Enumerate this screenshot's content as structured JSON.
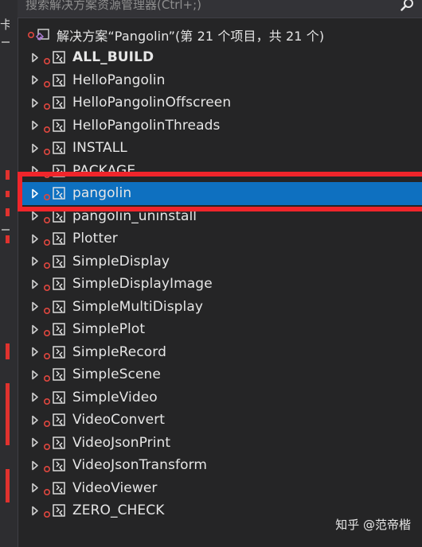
{
  "search": {
    "placeholder": "搜索解决方案资源管理器(Ctrl+;)"
  },
  "gutter": {
    "glyph": "卡"
  },
  "solution": {
    "label": "解决方案“Pangolin”(第 21 个项目，共 21 个)"
  },
  "projects": [
    {
      "label": "ALL_BUILD",
      "bold": true
    },
    {
      "label": "HelloPangolin"
    },
    {
      "label": "HelloPangolinOffscreen"
    },
    {
      "label": "HelloPangolinThreads"
    },
    {
      "label": "INSTALL"
    },
    {
      "label": "PACKAGE"
    },
    {
      "label": "pangolin",
      "selected": true
    },
    {
      "label": "pangolin_uninstall"
    },
    {
      "label": "Plotter"
    },
    {
      "label": "SimpleDisplay"
    },
    {
      "label": "SimpleDisplayImage"
    },
    {
      "label": "SimpleMultiDisplay"
    },
    {
      "label": "SimplePlot"
    },
    {
      "label": "SimpleRecord"
    },
    {
      "label": "SimpleScene"
    },
    {
      "label": "SimpleVideo"
    },
    {
      "label": "VideoConvert"
    },
    {
      "label": "VideoJsonPrint"
    },
    {
      "label": "VideoJsonTransform"
    },
    {
      "label": "VideoViewer"
    },
    {
      "label": "ZERO_CHECK"
    }
  ],
  "colors": {
    "selection": "#0e70c0",
    "highlight": "#f0252b",
    "background": "#252526",
    "text": "#e6e6e6"
  },
  "watermark": "知乎 @范帝楷"
}
